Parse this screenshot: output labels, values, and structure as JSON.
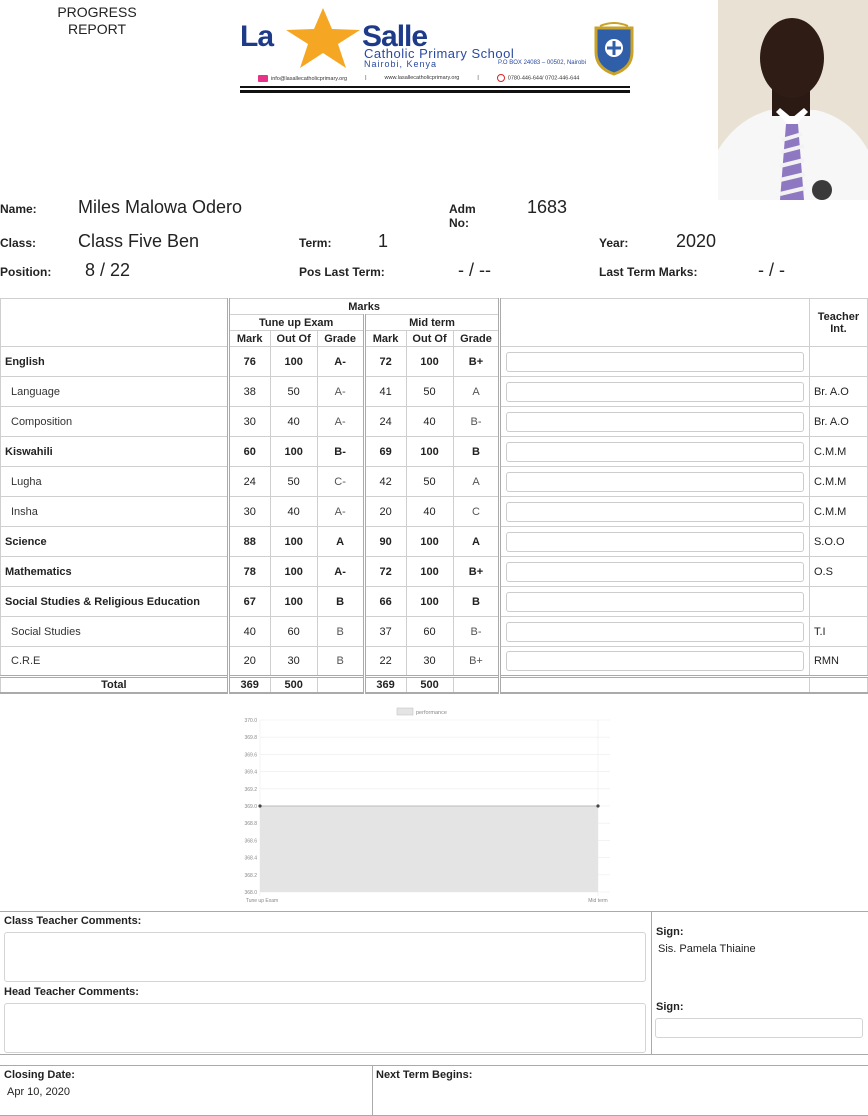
{
  "header": {
    "report_title_line1": "PROGRESS",
    "report_title_line2": "REPORT",
    "logo_la": "La",
    "logo_salle": "Salle",
    "school_name": "Catholic Primary School",
    "school_city": "Nairobi, Kenya",
    "school_box": "P.O BOX 24083 – 00502, Nairobi",
    "email": "info@lasallecatholicprimary.org",
    "website": "www.lasallecatholicprimary.org",
    "phone": "0780-446-644/ 0702-446-644"
  },
  "student": {
    "name_label": "Name:",
    "name": "Miles Malowa Odero",
    "adm_label_1": "Adm",
    "adm_label_2": "No:",
    "adm": "1683",
    "class_label": "Class:",
    "class": "Class Five Ben",
    "term_label": "Term:",
    "term": "1",
    "year_label": "Year:",
    "year": "2020",
    "position_label": "Position:",
    "position": "8 / 22",
    "pos_last_label": "Pos Last Term:",
    "pos_last": "- / --",
    "last_marks_label": "Last Term Marks:",
    "last_marks": "- / -"
  },
  "table": {
    "marks_header": "Marks",
    "teacher_header_1": "Teacher",
    "teacher_header_2": "Int.",
    "exam1": "Tune up Exam",
    "exam2": "Mid term",
    "col_mark": "Mark",
    "col_outof": "Out Of",
    "col_grade": "Grade",
    "rows": [
      {
        "subject": "English",
        "kind": "main",
        "m1": "76",
        "o1": "100",
        "g1": "A-",
        "m2": "72",
        "o2": "100",
        "g2": "B+",
        "teacher": ""
      },
      {
        "subject": "Language",
        "kind": "sub",
        "m1": "38",
        "o1": "50",
        "g1": "A-",
        "m2": "41",
        "o2": "50",
        "g2": "A",
        "teacher": "Br. A.O"
      },
      {
        "subject": "Composition",
        "kind": "sub",
        "m1": "30",
        "o1": "40",
        "g1": "A-",
        "m2": "24",
        "o2": "40",
        "g2": "B-",
        "teacher": "Br. A.O"
      },
      {
        "subject": "Kiswahili",
        "kind": "main",
        "m1": "60",
        "o1": "100",
        "g1": "B-",
        "m2": "69",
        "o2": "100",
        "g2": "B",
        "teacher": "C.M.M"
      },
      {
        "subject": "Lugha",
        "kind": "sub",
        "m1": "24",
        "o1": "50",
        "g1": "C-",
        "m2": "42",
        "o2": "50",
        "g2": "A",
        "teacher": "C.M.M"
      },
      {
        "subject": "Insha",
        "kind": "sub",
        "m1": "30",
        "o1": "40",
        "g1": "A-",
        "m2": "20",
        "o2": "40",
        "g2": "C",
        "teacher": "C.M.M"
      },
      {
        "subject": "Science",
        "kind": "main",
        "m1": "88",
        "o1": "100",
        "g1": "A",
        "m2": "90",
        "o2": "100",
        "g2": "A",
        "teacher": "S.O.O"
      },
      {
        "subject": "Mathematics",
        "kind": "main",
        "m1": "78",
        "o1": "100",
        "g1": "A-",
        "m2": "72",
        "o2": "100",
        "g2": "B+",
        "teacher": "O.S"
      },
      {
        "subject": "Social Studies & Religious Education",
        "kind": "main",
        "m1": "67",
        "o1": "100",
        "g1": "B",
        "m2": "66",
        "o2": "100",
        "g2": "B",
        "teacher": ""
      },
      {
        "subject": "Social Studies",
        "kind": "sub",
        "m1": "40",
        "o1": "60",
        "g1": "B",
        "m2": "37",
        "o2": "60",
        "g2": "B-",
        "teacher": "T.I"
      },
      {
        "subject": "C.R.E",
        "kind": "sub",
        "m1": "20",
        "o1": "30",
        "g1": "B",
        "m2": "22",
        "o2": "30",
        "g2": "B+",
        "teacher": "RMN"
      }
    ],
    "total_label": "Total",
    "total_m1": "369",
    "total_o1": "500",
    "total_m2": "369",
    "total_o2": "500"
  },
  "chart_data": {
    "type": "area",
    "categories": [
      "Tune up Exam",
      "Mid term"
    ],
    "series": [
      {
        "name": "performance",
        "values": [
          369,
          369
        ]
      }
    ],
    "ylim": [
      368,
      370
    ],
    "yticks": [
      "370.0",
      "369.8",
      "369.6",
      "369.4",
      "369.2",
      "369.0",
      "368.8",
      "368.6",
      "368.4",
      "368.2",
      "368.0"
    ],
    "x_tick_labels": [
      "Tune up Exam",
      "Mid term"
    ],
    "legend": "top",
    "grid": true,
    "fill_color": "#e4e4e4",
    "line_color": "#bdbdbd"
  },
  "comments": {
    "class_teacher_label": "Class Teacher Comments:",
    "head_teacher_label": "Head Teacher Comments:",
    "sign_label": "Sign:",
    "class_teacher_sign": "Sis. Pamela Thiaine",
    "closing_label": "Closing Date:",
    "closing_date": "Apr 10, 2020",
    "next_term_label": "Next Term Begins:"
  }
}
